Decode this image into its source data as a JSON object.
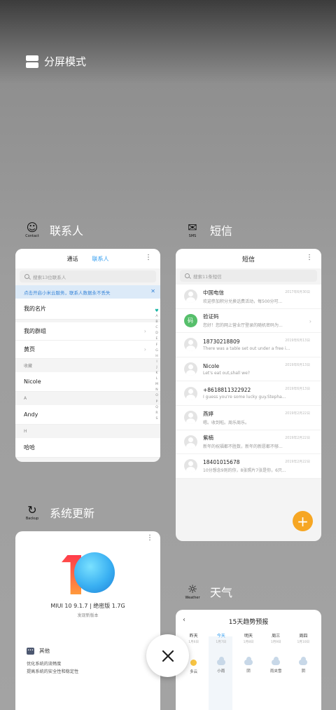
{
  "split_mode": {
    "label": "分屏模式"
  },
  "apps": {
    "contacts": {
      "name": "联系人",
      "icon_caption": "Contact",
      "tabs": [
        "通话",
        "联系人"
      ],
      "search_placeholder": "搜索13位联系人",
      "banner": "点击开启小米云服务，联系人数据永不丢失",
      "rows": {
        "my_card": "我的名片",
        "my_groups": "我的群组",
        "yellow_pages": "黄页",
        "sec_fav": "收藏",
        "nicole": "Nicole",
        "sec_a": "A",
        "andy": "Andy",
        "sec_h": "H",
        "haha": "哈哈"
      },
      "alphabet": [
        "♥",
        "A",
        "B",
        "C",
        "D",
        "E",
        "F",
        "G",
        "H",
        "I",
        "J",
        "K",
        "L",
        "M",
        "N",
        "O",
        "P",
        "Q",
        "R",
        "S"
      ]
    },
    "sms": {
      "name": "短信",
      "icon_caption": "SMS",
      "title": "短信",
      "search_placeholder": "搜索11条短信",
      "messages": [
        {
          "name": "中国电信",
          "preview": "欢迎参加积分兑换话费活动，每500分可...",
          "date": "2017年6月30日"
        },
        {
          "name": "验证码",
          "preview": "您好！您的网上营业厅登录的随机密码为...",
          "date": ""
        },
        {
          "name": "18730218809",
          "preview": "There was a table set out under a free i...",
          "date": "2019年6月13日"
        },
        {
          "name": "Nicole",
          "preview": "Let's eat out,shall we?",
          "date": "2019年6月13日"
        },
        {
          "name": "+8618811322922",
          "preview": "I guess you're some lucky guy.Stepha...",
          "date": "2019年6月13日"
        },
        {
          "name": "燕婷",
          "preview": "嗯。收到啦。周乐周乐。",
          "date": "2019年2月22日"
        },
        {
          "name": "紫楠",
          "preview": "新年的祝福都不胜数，新年的新愿都不够...",
          "date": "2019年2月22日"
        },
        {
          "name": "18401015678",
          "preview": "10分想念9则的你，8张照片7张是你，6只...",
          "date": "2019年2月22日"
        }
      ],
      "verify_avatar": "码",
      "fab": "+"
    },
    "update": {
      "name": "系统更新",
      "icon_caption": "Backup",
      "version": "MIUI 10 9.1.7 | 绝密版 1.7G",
      "status": "发现新版本",
      "section": "其他",
      "notes": [
        "优化系统的流畅度",
        "提高系统的安全性和稳定性"
      ]
    },
    "weather": {
      "name": "天气",
      "icon_caption": "Weather",
      "title": "15天趋势预报",
      "days": [
        {
          "d": "昨天",
          "dt": "1月6日"
        },
        {
          "d": "今天",
          "dt": "1月7日"
        },
        {
          "d": "明天",
          "dt": "1月8日"
        },
        {
          "d": "周三",
          "dt": "1月9日"
        },
        {
          "d": "周四",
          "dt": "1月10日"
        }
      ],
      "conditions": [
        "多云",
        "小雨",
        "阴",
        "雨夹雪",
        "阴"
      ]
    }
  },
  "colors": {
    "accent_blue": "#2f9cf0",
    "fab_orange": "#f6a623"
  }
}
